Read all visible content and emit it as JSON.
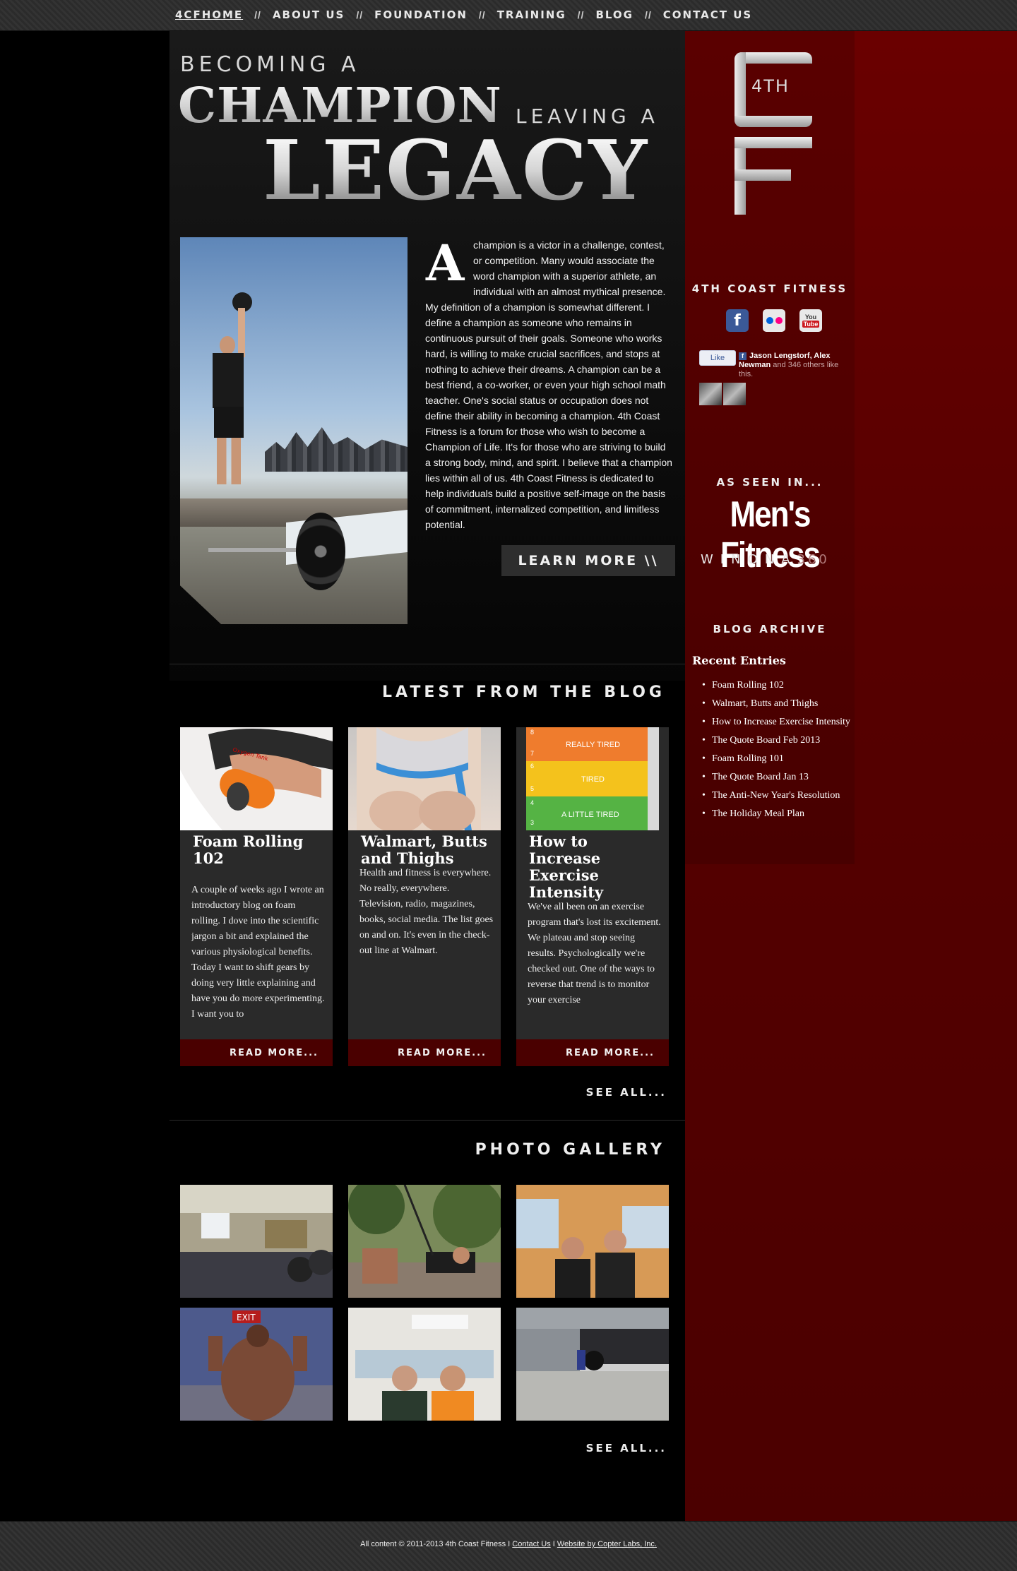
{
  "nav": {
    "items": [
      {
        "label": "4CFHOME"
      },
      {
        "label": "ABOUT US"
      },
      {
        "label": "FOUNDATION"
      },
      {
        "label": "TRAINING"
      },
      {
        "label": "BLOG"
      },
      {
        "label": "CONTACT US"
      }
    ],
    "separator": "//"
  },
  "hero": {
    "line1": "BECOMING A",
    "line2": "CHAMPION",
    "line3": "LEAVING A",
    "line4": "LEGACY",
    "dropcap": "A",
    "body": "champion is a victor in a challenge, contest, or competition. Many would associate the word champion with a superior athlete, an individual with an almost mythical presence. My definition of a champion is somewhat different. I define a champion as someone who remains in continuous pursuit of their goals. Someone who works hard, is willing to make crucial sacrifices, and stops at nothing to achieve their dreams. A champion can be a best friend, a co-worker, or even your high school math teacher. One's social status or occupation does not define their ability in becoming a champion. 4th Coast Fitness is a forum for those who wish to become a Champion of Life. It's for those who are striving to build a strong body, mind, and spirit. I believe that a champion lies within all of us. 4th Coast Fitness is dedicated to help individuals build a positive self-image on the basis of commitment, internalized competition, and limitless potential.",
    "learn_more": "LEARN MORE \\\\"
  },
  "blog": {
    "title": "LATEST FROM THE BLOG",
    "posts": [
      {
        "title": "Foam Rolling 102",
        "excerpt": "A couple of weeks ago I wrote an introductory blog on foam rolling.  I dove into the scientific jargon a bit and explained the various physiological benefits. Today I want to shift gears by doing very little explaining and have you do more experimenting. I want you to",
        "read_more": "READ MORE..."
      },
      {
        "title": "Walmart, Butts and Thighs",
        "excerpt": "Health and fitness is everywhere. No really, everywhere. Television, radio, magazines, books, social media. The list goes on and on. It's even in the check-out line at Walmart.",
        "read_more": "READ MORE..."
      },
      {
        "title": "How to Increase Exercise Intensity",
        "excerpt": "We've all been on an exercise program that's lost its excitement. We plateau and stop seeing results. Psychologically we're checked out. One of the ways to reverse that trend is to monitor your exercise",
        "read_more": "READ MORE..."
      }
    ],
    "thumb3_labels": {
      "really": "REALLY TIRED",
      "tired": "TIRED",
      "little": "A LITTLE TIRED",
      "n8": "8",
      "n7": "7",
      "n6": "6",
      "n5": "5",
      "n4": "4",
      "n3": "3"
    },
    "thumb1_label": "Oxygen Tank",
    "see_all": "SEE ALL..."
  },
  "gallery": {
    "title": "PHOTO GALLERY",
    "exit_sign": "EXIT",
    "see_all": "SEE ALL..."
  },
  "sidebar": {
    "logo_text": "4TH",
    "brand_title": "4TH COAST FITNESS",
    "social": [
      "facebook-icon",
      "flickr-icon",
      "youtube-icon"
    ],
    "fb_icon_glyph": "f",
    "yt_you": "You",
    "yt_tube": "Tube",
    "fb_like": {
      "button": "Like",
      "mini": "f",
      "names": "Jason Lengstorf, Alex Newman",
      "rest": " and 346 others like this."
    },
    "seen_in_title": "AS SEEN IN...",
    "mens_fitness": "Men's Fitness",
    "winona": "WINONA",
    "winona_num": "360",
    "archive_title": "BLOG ARCHIVE",
    "recent_title": "Recent Entries",
    "recent": [
      "Foam Rolling 102",
      "Walmart, Butts and Thighs",
      "How to Increase Exercise Intensity",
      "The Quote Board Feb 2013",
      "Foam Rolling 101",
      "The Quote Board Jan 13",
      "The Anti-New Year's Resolution",
      "The Holiday Meal Plan"
    ]
  },
  "footer": {
    "copyright": "All content © 2011-2013 4th Coast Fitness",
    "sep1": " I ",
    "contact": "Contact Us",
    "sep2": " I ",
    "credit": "Website by Copter Labs, Inc."
  },
  "colors": {
    "sidebar": "#560000",
    "readmore_bar": "#4a0000",
    "card_bg": "#2a2a2a"
  }
}
